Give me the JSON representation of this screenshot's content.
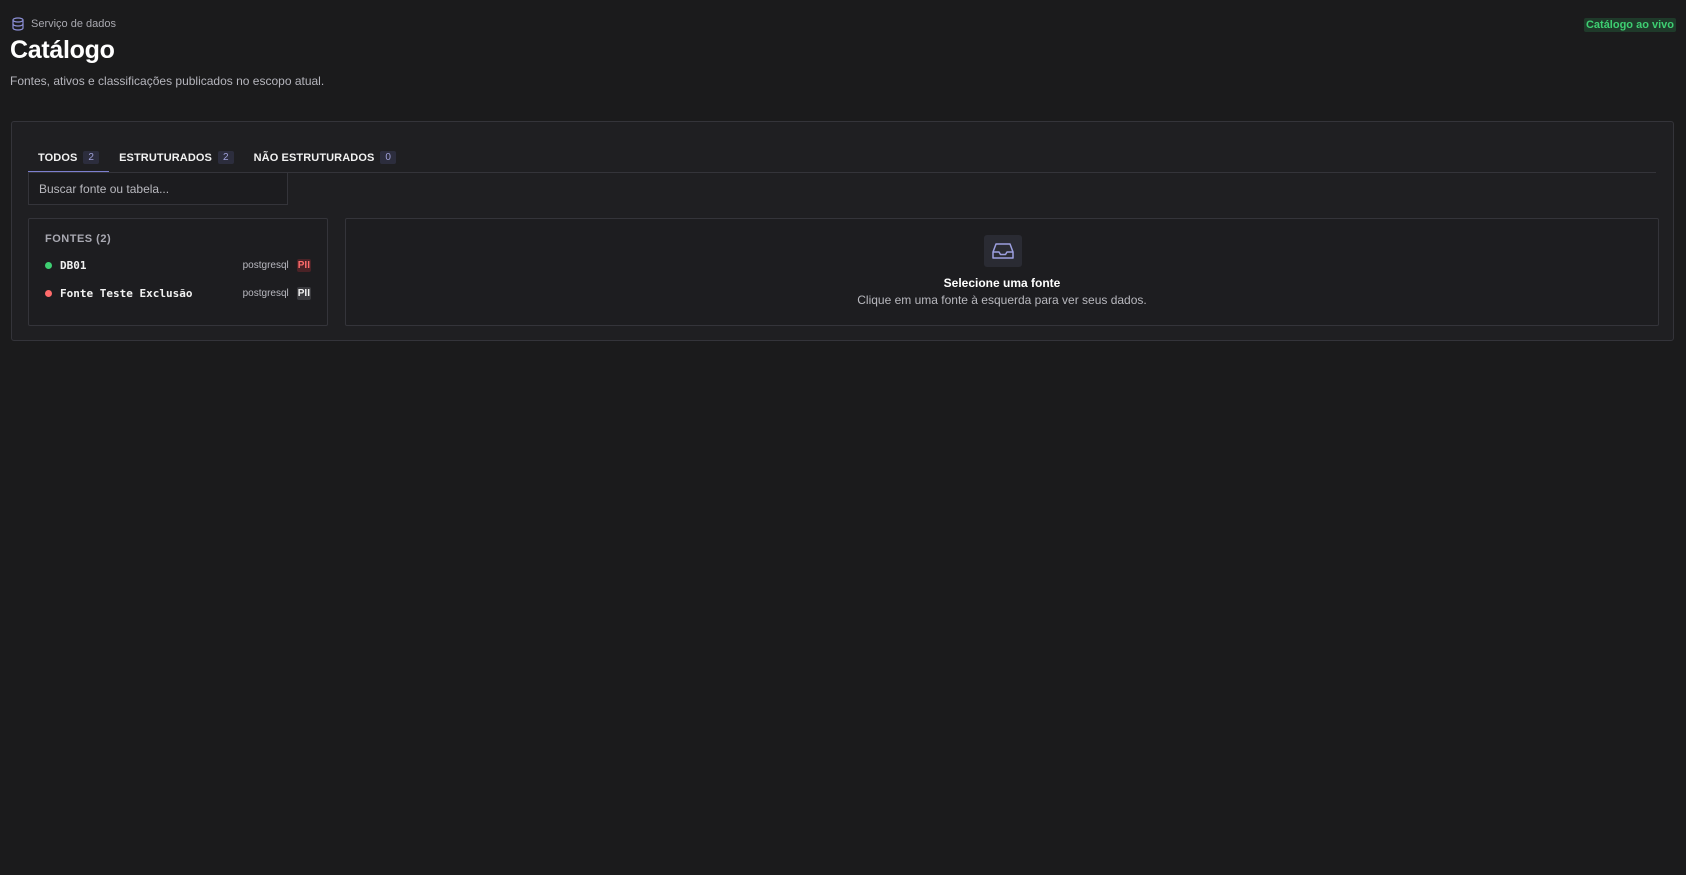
{
  "header": {
    "breadcrumb": "Serviço de dados",
    "breadcrumb_icon": "database-icon",
    "title": "Catálogo",
    "subtitle": "Fontes, ativos e classificações publicados no escopo atual.",
    "live_badge": "Catálogo ao vivo",
    "live_color": "#3ecf72"
  },
  "tabs": [
    {
      "label": "TODOS",
      "count": "2",
      "active": true
    },
    {
      "label": "ESTRUTURADOS",
      "count": "2",
      "active": false
    },
    {
      "label": "NÃO ESTRUTURADOS",
      "count": "0",
      "active": false
    }
  ],
  "search": {
    "placeholder": "Buscar fonte ou tabela..."
  },
  "sources": {
    "header": "FONTES (2)",
    "items": [
      {
        "name": "DB01",
        "type": "postgresql",
        "badge": "PII",
        "status_color": "#3ecf72",
        "badge_color": "#ff6b6b",
        "badge_bg": "#4a2226"
      },
      {
        "name": "Fonte Teste Exclusão",
        "type": "postgresql",
        "badge": "PII",
        "status_color": "#ff6b6b",
        "badge_color": "#f2f2f2",
        "badge_bg": "#3a3a3e"
      }
    ]
  },
  "detail": {
    "icon": "inbox-icon",
    "title": "Selecione uma fonte",
    "description": "Clique em uma fonte à esquerda para ver seus dados."
  },
  "colors": {
    "accent": "#7d7fd0",
    "background": "#1b1b1c"
  }
}
